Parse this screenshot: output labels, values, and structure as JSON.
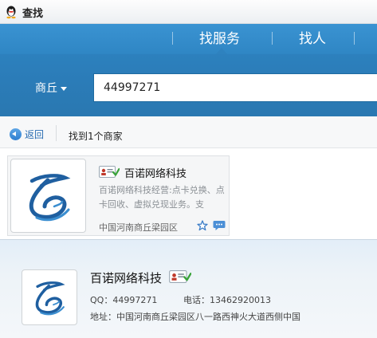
{
  "window": {
    "title": "查找"
  },
  "tabs": [
    {
      "label": "找服务"
    },
    {
      "label": "找人"
    }
  ],
  "search": {
    "city": "商丘",
    "query": "44997271"
  },
  "toolbar": {
    "back_label": "返回",
    "result_count": "找到1个商家"
  },
  "result": {
    "name": "百诺网络科技",
    "description": "百诺网络科技经营:点卡兑换、点卡回收、虚拟兑现业务。支",
    "address": "中国河南商丘梁园区"
  },
  "detail": {
    "name": "百诺网络科技",
    "qq_label": "QQ：",
    "qq": "44997271",
    "phone_label": "电话：",
    "phone": "13462920013",
    "address_label": "地址：",
    "address": "中国河南商丘梁园区八一路西神火大道西侧中国"
  },
  "colors": {
    "accent": "#2b7cb8",
    "link": "#2a6db2",
    "logo": "#1f5fa0"
  },
  "icons": [
    "qq-penguin-icon",
    "back-arrow-icon",
    "id-card-badge-icon",
    "star-icon",
    "chat-bubble-icon",
    "company-logo-icon"
  ]
}
